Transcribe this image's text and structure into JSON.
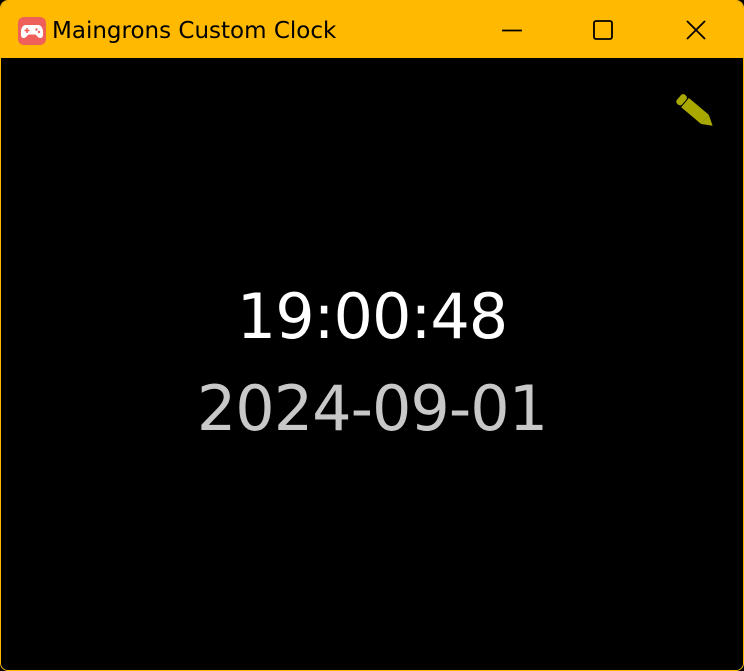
{
  "window": {
    "title": "Maingrons Custom Clock",
    "app_icon": "gamepad-icon",
    "controls": {
      "minimize_icon": "minimize-icon",
      "maximize_icon": "maximize-icon",
      "close_icon": "close-icon"
    }
  },
  "clock": {
    "time": "19:00:48",
    "date": "2024-09-01",
    "edit_icon": "pencil-icon"
  },
  "colors": {
    "accent": "#FFB900",
    "background": "#000000",
    "time_text": "#FFFFFF",
    "date_text": "#C8C8C8",
    "edit_icon": "#A8A800",
    "app_icon_bg": "#F0605A"
  }
}
